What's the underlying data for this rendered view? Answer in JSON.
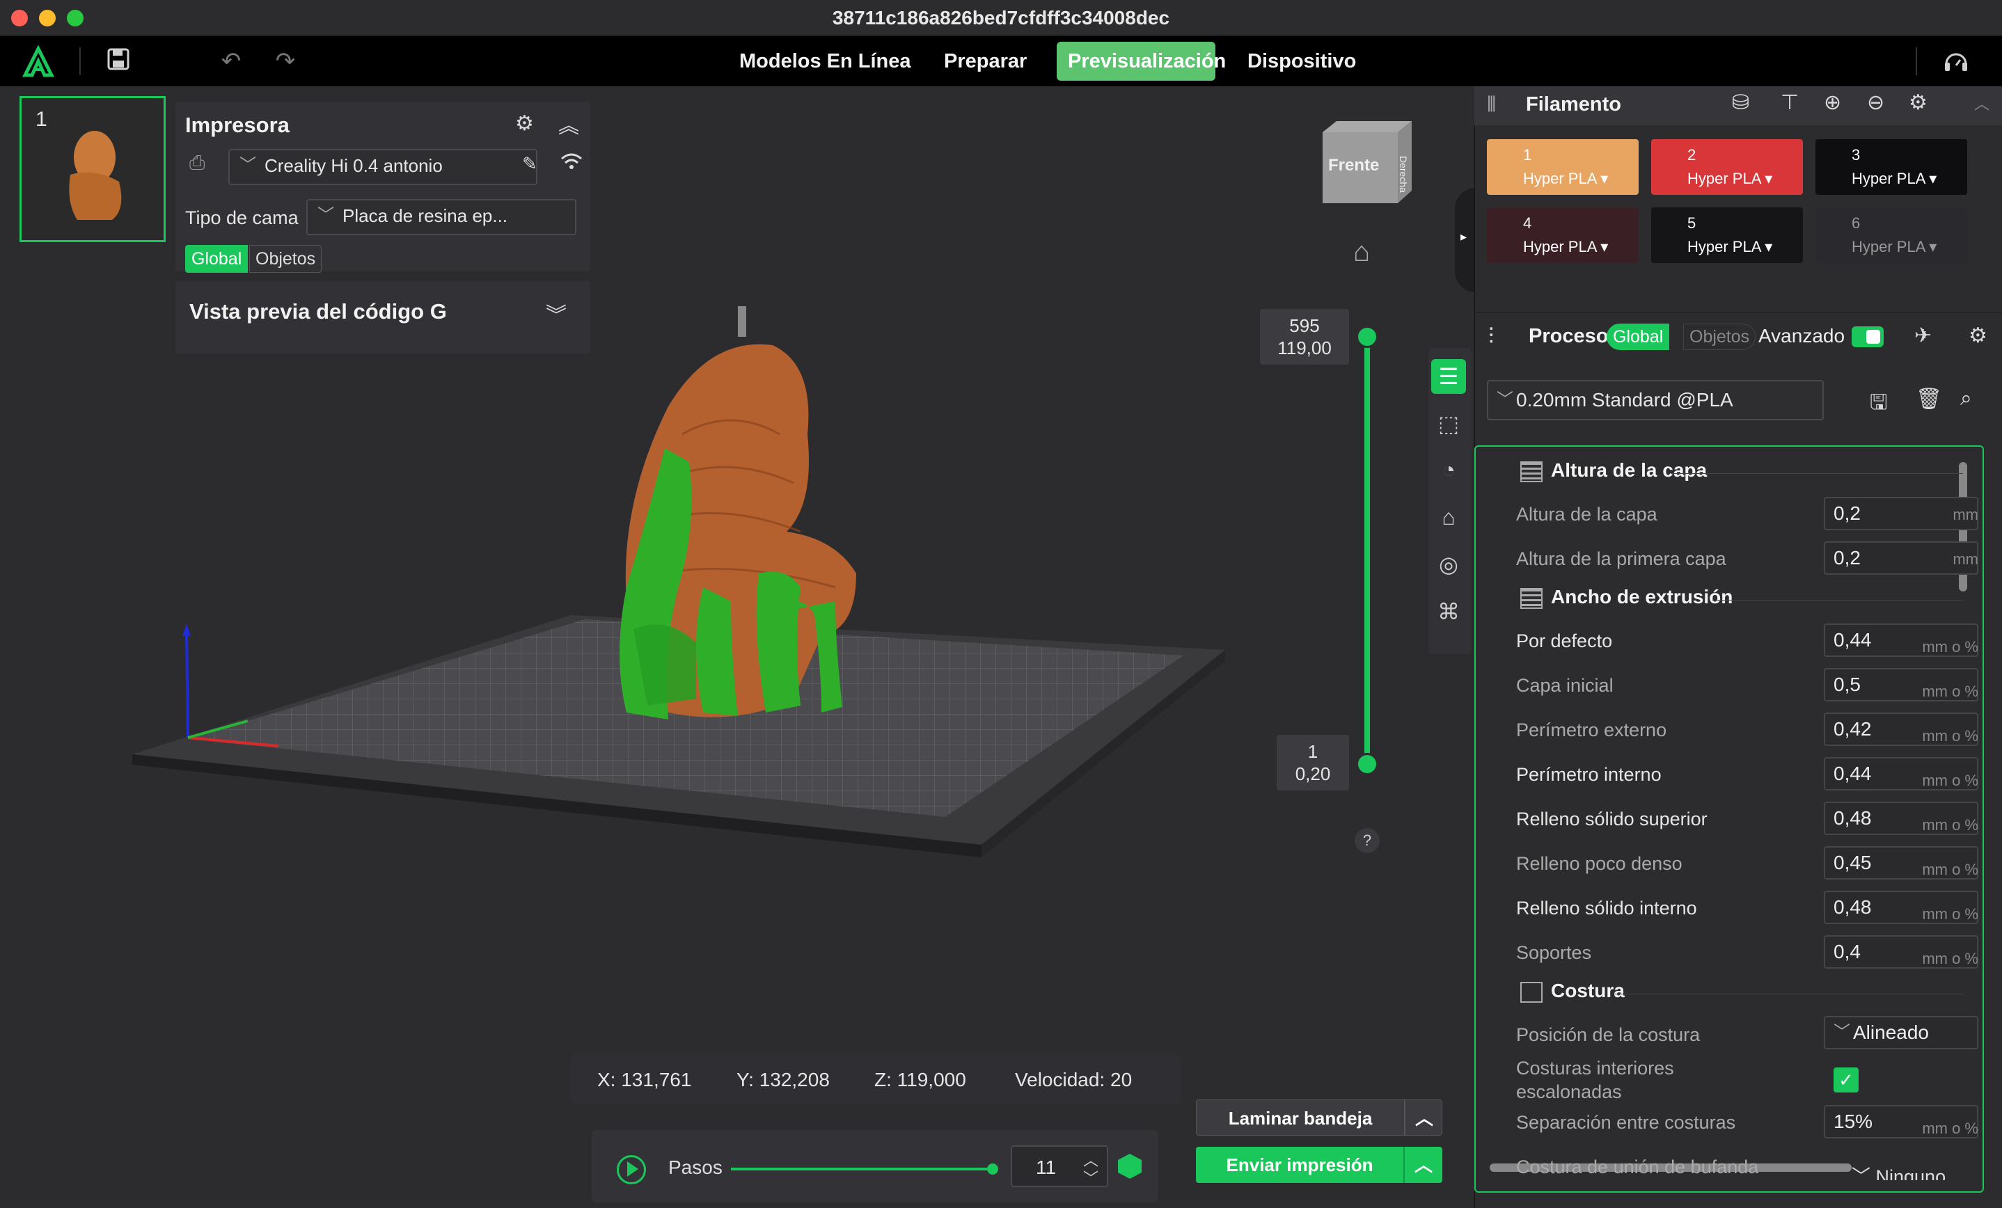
{
  "window": {
    "title": "38711c186a826bed7cfdff3c34008dec"
  },
  "nav": {
    "tabs": [
      "Modelos En Línea",
      "Preparar",
      "Previsualización",
      "Dispositivo"
    ],
    "active": "Previsualización"
  },
  "plate": {
    "number": "1"
  },
  "printer": {
    "title": "Impresora",
    "name": "Creality Hi 0.4 antonio",
    "bed_label": "Tipo de cama",
    "bed_value": "Placa de resina ep...",
    "seg_global": "Global",
    "seg_objects": "Objetos"
  },
  "gcode_preview": {
    "title": "Vista previa del código G"
  },
  "view_cube": {
    "front": "Frente",
    "right": "Derecha"
  },
  "layer_slider": {
    "top_layer": "595",
    "top_height": "119,00",
    "bottom_layer": "1",
    "bottom_height": "0,20"
  },
  "help": "?",
  "coords": {
    "x": "X: 131,761",
    "y": "Y: 132,208",
    "z": "Z: 119,000",
    "speed": "Velocidad: 20"
  },
  "playback": {
    "label": "Pasos",
    "value": "11"
  },
  "actions": {
    "slice": "Laminar bandeja",
    "send": "Enviar impresión"
  },
  "filament": {
    "title": "Filamento",
    "slots": [
      {
        "n": "1",
        "type": "Hyper PLA",
        "color": "#e8a461"
      },
      {
        "n": "2",
        "type": "Hyper PLA",
        "color": "#d9363a"
      },
      {
        "n": "3",
        "type": "Hyper PLA",
        "color": "#0e0e10"
      },
      {
        "n": "4",
        "type": "Hyper PLA",
        "color": "#3a1f24"
      },
      {
        "n": "5",
        "type": "Hyper PLA",
        "color": "#151517"
      },
      {
        "n": "6",
        "type": "Hyper PLA",
        "color": "#2a2a2e"
      }
    ]
  },
  "process": {
    "title": "Proceso",
    "seg_global": "Global",
    "seg_objects": "Objetos",
    "advanced": "Avanzado",
    "preset": "0.20mm Standard @PLA"
  },
  "settings": {
    "layer_height_section": "Altura de la capa",
    "layer_height": {
      "label": "Altura de la capa",
      "value": "0,2",
      "unit": "mm"
    },
    "first_layer_height": {
      "label": "Altura de la primera capa",
      "value": "0,2",
      "unit": "mm"
    },
    "extrusion_section": "Ancho de extrusión",
    "default_width": {
      "label": "Por defecto",
      "value": "0,44",
      "unit": "mm o %"
    },
    "initial_layer": {
      "label": "Capa inicial",
      "value": "0,5",
      "unit": "mm o %"
    },
    "outer_wall": {
      "label": "Perímetro externo",
      "value": "0,42",
      "unit": "mm o %"
    },
    "inner_wall": {
      "label": "Perímetro interno",
      "value": "0,44",
      "unit": "mm o %"
    },
    "top_surface": {
      "label": "Relleno sólido superior",
      "value": "0,48",
      "unit": "mm o %"
    },
    "sparse_infill": {
      "label": "Relleno poco denso",
      "value": "0,45",
      "unit": "mm o %"
    },
    "internal_solid": {
      "label": "Relleno sólido interno",
      "value": "0,48",
      "unit": "mm o %"
    },
    "support": {
      "label": "Soportes",
      "value": "0,4",
      "unit": "mm o %"
    },
    "seam_section": "Costura",
    "seam_position": {
      "label": "Posición de la costura",
      "value": "Alineado"
    },
    "staggered_seams": {
      "label_line1": "Costuras interiores",
      "label_line2": "escalonadas"
    },
    "seam_gap": {
      "label": "Separación entre costuras",
      "value": "15%",
      "unit": "mm o %"
    },
    "scarf_seam": {
      "label": "Costura de unión de bufanda",
      "value": "Ninguno"
    }
  }
}
